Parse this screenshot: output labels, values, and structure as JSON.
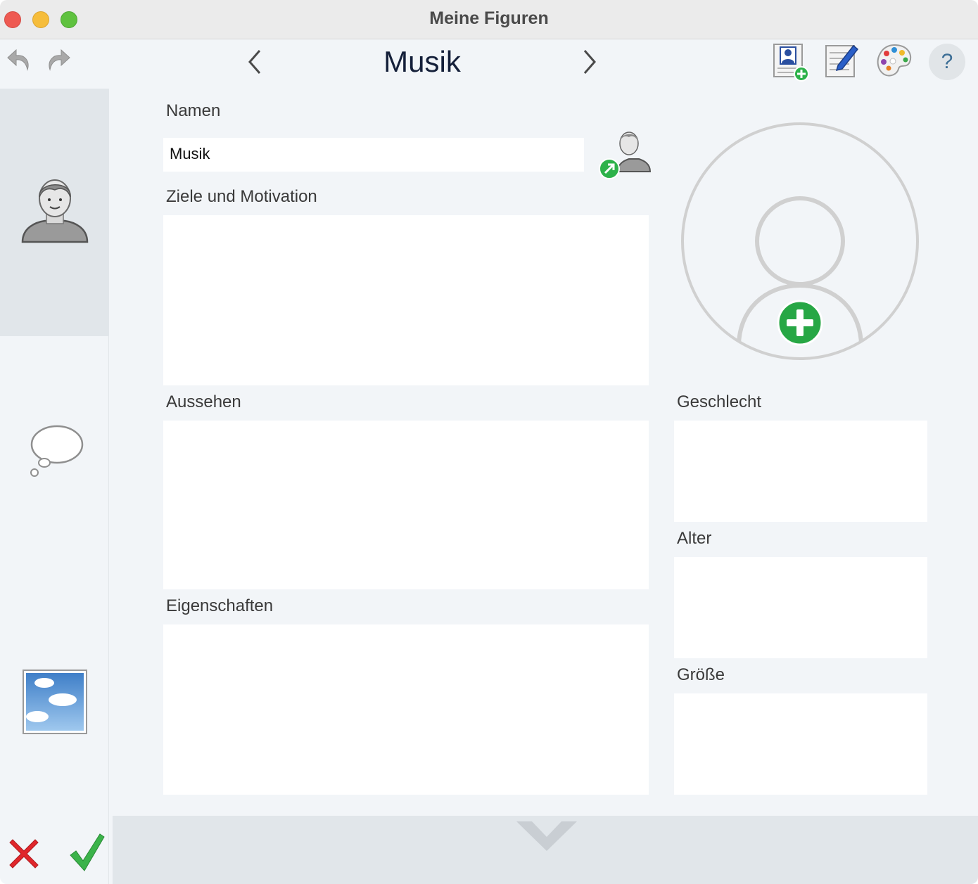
{
  "window": {
    "title": "Meine Figuren"
  },
  "toolbar": {
    "doc_title": "Musik",
    "icons": [
      "undo-icon",
      "redo-icon",
      "prev-arrow-icon",
      "next-arrow-icon",
      "add-character-icon",
      "edit-notes-icon",
      "palette-icon",
      "help-icon"
    ],
    "help_glyph": "?"
  },
  "sidebar": {
    "tabs": [
      {
        "name": "person-tab",
        "icon": "person-icon",
        "active": true
      },
      {
        "name": "thought-tab",
        "icon": "thought-bubble-icon",
        "active": false
      },
      {
        "name": "image-tab",
        "icon": "sky-image-icon",
        "active": false
      }
    ]
  },
  "form": {
    "name_label": "Namen",
    "name_value": "Musik",
    "goals_label": "Ziele und Motivation",
    "goals_value": "",
    "appearance_label": "Aussehen",
    "appearance_value": "",
    "traits_label": "Eigenschaften",
    "traits_value": "",
    "gender_label": "Geschlecht",
    "gender_value": "",
    "age_label": "Alter",
    "age_value": "",
    "height_label": "Größe",
    "height_value": ""
  },
  "colors": {
    "accent_green": "#27a745",
    "cancel_red": "#e0262b",
    "confirm_green": "#3bb34a"
  }
}
